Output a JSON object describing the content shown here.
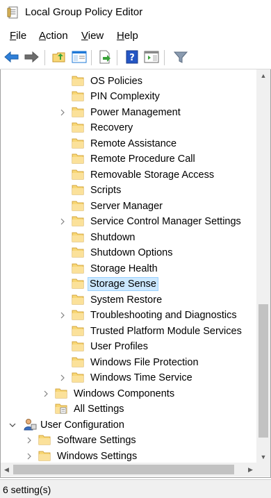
{
  "window": {
    "title": "Local Group Policy Editor"
  },
  "menubar": {
    "items": [
      {
        "mnemonic": "F",
        "rest": "ile"
      },
      {
        "mnemonic": "A",
        "rest": "ction"
      },
      {
        "mnemonic": "V",
        "rest": "iew"
      },
      {
        "mnemonic": "H",
        "rest": "elp"
      }
    ]
  },
  "toolbar": {
    "buttons": [
      "back-arrow-icon",
      "forward-arrow-icon",
      "up-folder-icon",
      "show-hide-console-tree-icon",
      "export-list-icon",
      "help-icon",
      "show-hide-action-pane-icon",
      "filter-icon"
    ]
  },
  "tree": {
    "items": [
      {
        "label": "OS Policies"
      },
      {
        "label": "PIN Complexity"
      },
      {
        "label": "Power Management"
      },
      {
        "label": "Recovery"
      },
      {
        "label": "Remote Assistance"
      },
      {
        "label": "Remote Procedure Call"
      },
      {
        "label": "Removable Storage Access"
      },
      {
        "label": "Scripts"
      },
      {
        "label": "Server Manager"
      },
      {
        "label": "Service Control Manager Settings"
      },
      {
        "label": "Shutdown"
      },
      {
        "label": "Shutdown Options"
      },
      {
        "label": "Storage Health"
      },
      {
        "label": "Storage Sense"
      },
      {
        "label": "System Restore"
      },
      {
        "label": "Troubleshooting and Diagnostics"
      },
      {
        "label": "Trusted Platform Module Services"
      },
      {
        "label": "User Profiles"
      },
      {
        "label": "Windows File Protection"
      },
      {
        "label": "Windows Time Service"
      },
      {
        "label": "Windows Components"
      },
      {
        "label": "All Settings"
      },
      {
        "label": "User Configuration"
      },
      {
        "label": "Software Settings"
      },
      {
        "label": "Windows Settings"
      }
    ],
    "selected": "Storage Sense"
  },
  "status": {
    "text": "6 setting(s)"
  },
  "colors": {
    "selection_bg": "#cce8ff",
    "selection_border": "#99d1ff",
    "folder": "#f8d775",
    "folder_dark": "#e0b34a",
    "accent": "#1e78d7"
  }
}
